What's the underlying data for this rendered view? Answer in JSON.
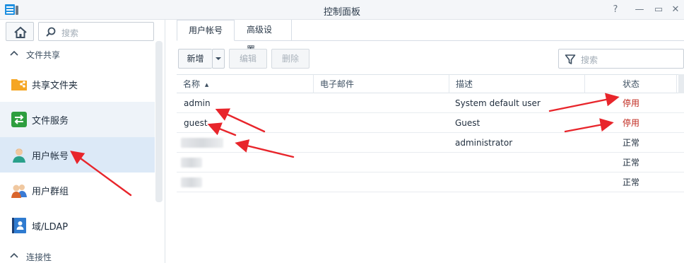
{
  "window": {
    "title": "控制面板",
    "buttons": {
      "help": "?",
      "minimize": "—",
      "maximize": "▭",
      "close": "✕"
    }
  },
  "sidebar": {
    "search_placeholder": "搜索",
    "sections": [
      {
        "label": "文件共享"
      },
      {
        "label": "连接性"
      }
    ],
    "items": [
      {
        "label": "共享文件夹",
        "icon": "shared-folder-icon"
      },
      {
        "label": "文件服务",
        "icon": "file-services-icon"
      },
      {
        "label": "用户帐号",
        "icon": "user-icon"
      },
      {
        "label": "用户群组",
        "icon": "group-icon"
      },
      {
        "label": "域/LDAP",
        "icon": "domain-ldap-icon"
      }
    ]
  },
  "tabs": [
    {
      "label": "用户帐号"
    },
    {
      "label": "高级设置"
    }
  ],
  "toolbar": {
    "create_label": "新增",
    "edit_label": "编辑",
    "delete_label": "删除",
    "filter_placeholder": "搜索"
  },
  "grid": {
    "columns": [
      "名称",
      "电子邮件",
      "描述",
      "状态"
    ],
    "sort_indicator": "▲",
    "rows": [
      {
        "name": "admin",
        "email": "",
        "description": "System default user",
        "status": "停用"
      },
      {
        "name": "guest",
        "email": "",
        "description": "Guest",
        "status": "停用"
      },
      {
        "name": "",
        "email": "",
        "description": "administrator",
        "status": "正常"
      },
      {
        "name": "",
        "email": "",
        "description": "",
        "status": "正常"
      },
      {
        "name": "",
        "email": "",
        "description": "",
        "status": "正常"
      }
    ]
  },
  "colors": {
    "accent": "#2f7bd0",
    "status_disabled": "#c0281e",
    "annotation_arrow": "#e8252b",
    "sidebar_active": "#dce9f7"
  }
}
